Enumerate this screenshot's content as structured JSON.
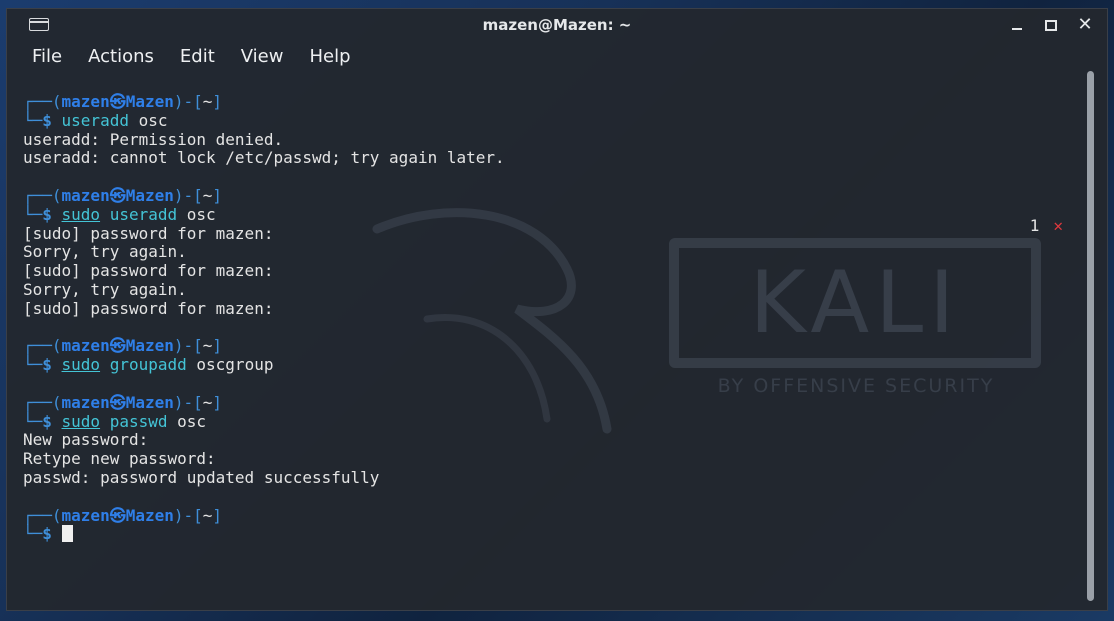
{
  "window": {
    "title": "mazen@Mazen: ~",
    "icon": "terminal-icon",
    "controls": [
      "minimize-icon",
      "maximize-icon",
      "close-icon"
    ],
    "close_glyph": "✕"
  },
  "menu": {
    "items": [
      "File",
      "Actions",
      "Edit",
      "View",
      "Help"
    ]
  },
  "prompt": {
    "user": "mazen",
    "host": "Mazen",
    "separator": "㉿",
    "dir": "~"
  },
  "session": [
    {
      "command": "useradd",
      "sudo": false,
      "args": "osc",
      "output": [
        "useradd: Permission denied.",
        "useradd: cannot lock /etc/passwd; try again later."
      ]
    },
    {
      "command": "useradd",
      "sudo": true,
      "args": "osc",
      "output": [
        "[sudo] password for mazen:",
        "Sorry, try again.",
        "[sudo] password for mazen:",
        "Sorry, try again.",
        "[sudo] password for mazen:"
      ]
    },
    {
      "command": "groupadd",
      "sudo": true,
      "args": "oscgroup",
      "output": []
    },
    {
      "command": "passwd",
      "sudo": true,
      "args": "osc",
      "output": [
        "New password:",
        "Retype new password:",
        "passwd: password updated successfully"
      ]
    }
  ],
  "exit_status": {
    "code": "1",
    "mark": "✕"
  },
  "wallpaper": {
    "brand": "KALI",
    "tagline": "BY OFFENSIVE SECURITY"
  },
  "colors": {
    "prompt_blue": "#2f7fe8",
    "command_cyan": "#44c4d6",
    "error_red": "#e0393e"
  }
}
